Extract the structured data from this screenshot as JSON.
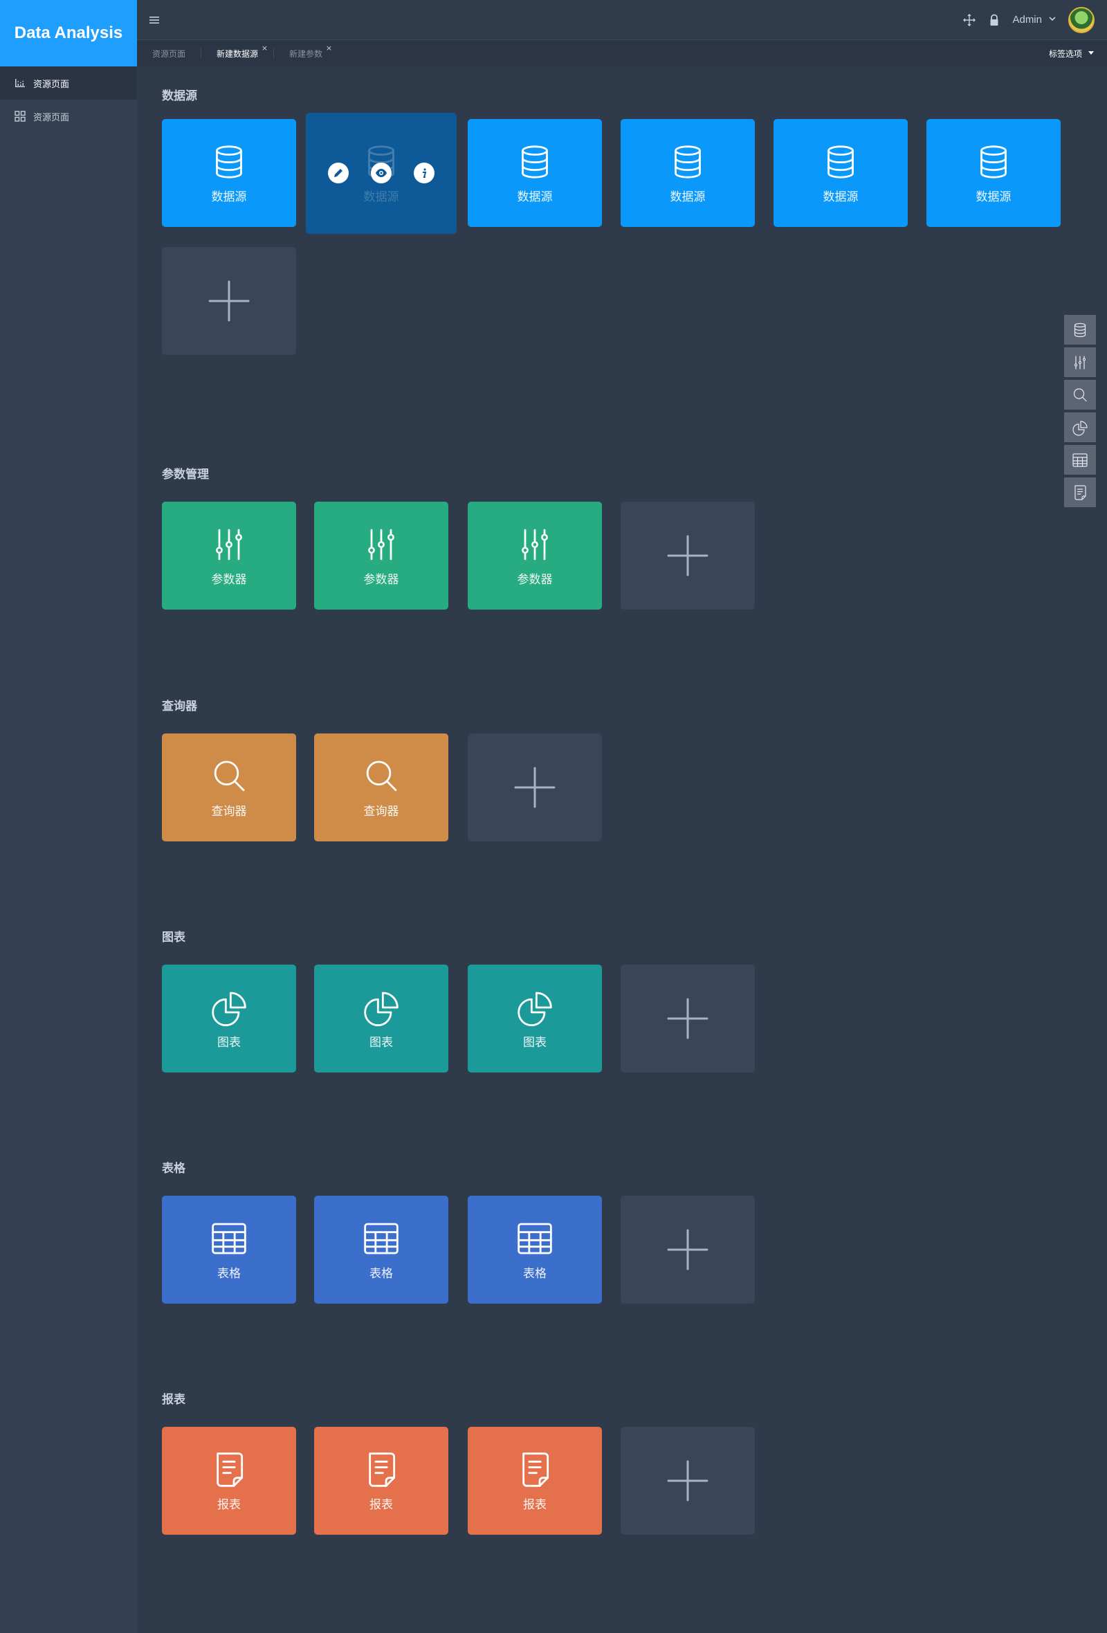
{
  "app": {
    "title": "Data Analysis"
  },
  "sidebar": {
    "items": [
      {
        "label": "资源页面",
        "icon": "bar-chart-icon",
        "active": true
      },
      {
        "label": "资源页面",
        "icon": "grid-icon",
        "active": false
      }
    ]
  },
  "header": {
    "user": "Admin",
    "icons": [
      "menu-icon",
      "move-icon",
      "lock-icon",
      "chevron-down-icon"
    ]
  },
  "tabs": {
    "items": [
      {
        "label": "资源页面",
        "active": false,
        "closable": false
      },
      {
        "label": "新建数据源",
        "active": true,
        "closable": true
      },
      {
        "label": "新建参数",
        "active": false,
        "closable": true
      }
    ],
    "close_glyph": "×",
    "options_label": "标签选项"
  },
  "sections": [
    {
      "title": "数据源",
      "card_label": "数据源",
      "count": 6,
      "color": "#0a98fa",
      "icon": "database-icon"
    },
    {
      "title": "参数管理",
      "card_label": "参数器",
      "count": 3,
      "color": "#27ab80",
      "icon": "sliders-icon"
    },
    {
      "title": "查询器",
      "card_label": "查询器",
      "count": 2,
      "color": "#cf8c48",
      "icon": "search-icon"
    },
    {
      "title": "图表",
      "card_label": "图表",
      "count": 3,
      "color": "#1c9a9a",
      "icon": "pie-chart-icon"
    },
    {
      "title": "表格",
      "card_label": "表格",
      "count": 3,
      "color": "#3c6ecb",
      "icon": "table-icon"
    },
    {
      "title": "报表",
      "card_label": "报表",
      "count": 3,
      "color": "#e4714b",
      "icon": "report-icon"
    }
  ],
  "hover_card": {
    "section": "数据源",
    "index": 1,
    "actions": [
      "edit-icon",
      "view-icon",
      "info-icon"
    ]
  },
  "float_toolbar": [
    "database-icon",
    "sliders-icon",
    "search-icon",
    "pie-chart-icon",
    "table-icon",
    "report-icon"
  ],
  "colors": {
    "accent": "#1e9fff",
    "background": "#2f3a4b",
    "sidebar": "#334052",
    "add_card": "#394558"
  }
}
